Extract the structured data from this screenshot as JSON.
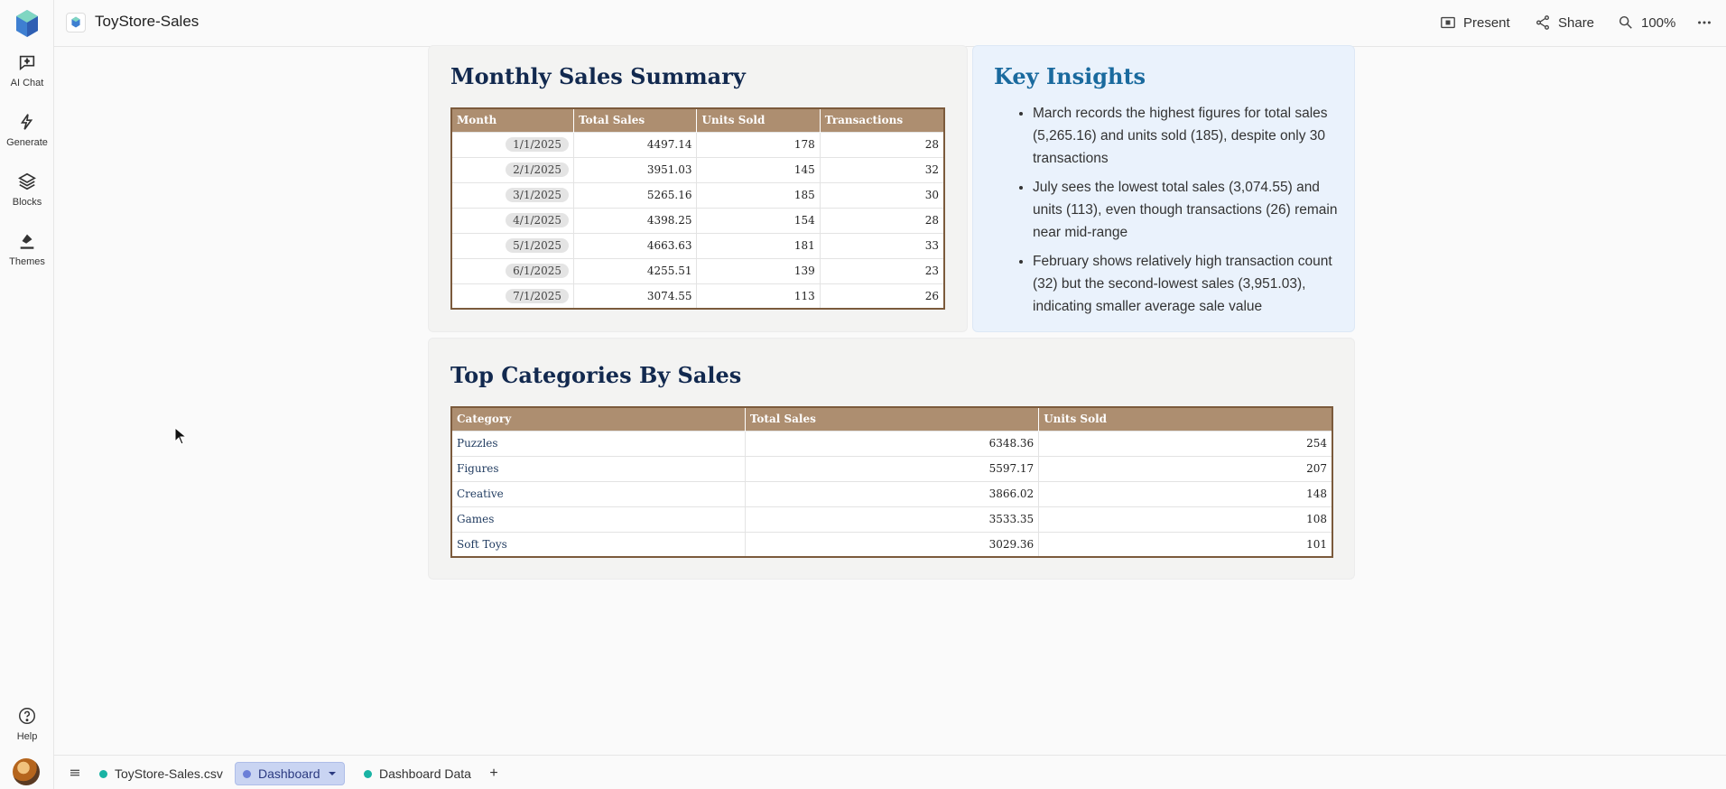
{
  "rail": {
    "items": [
      {
        "label": "AI Chat",
        "icon": "chat-icon"
      },
      {
        "label": "Generate",
        "icon": "sparkle-icon"
      },
      {
        "label": "Blocks",
        "icon": "layers-icon"
      },
      {
        "label": "Themes",
        "icon": "paint-icon"
      }
    ],
    "help_label": "Help"
  },
  "topbar": {
    "title": "ToyStore-Sales",
    "present_label": "Present",
    "share_label": "Share",
    "zoom_label": "100%"
  },
  "monthly": {
    "title": "Monthly Sales Summary",
    "headers": [
      "Month",
      "Total Sales",
      "Units Sold",
      "Transactions"
    ],
    "rows": [
      [
        "1/1/2025",
        "4497.14",
        "178",
        "28"
      ],
      [
        "2/1/2025",
        "3951.03",
        "145",
        "32"
      ],
      [
        "3/1/2025",
        "5265.16",
        "185",
        "30"
      ],
      [
        "4/1/2025",
        "4398.25",
        "154",
        "28"
      ],
      [
        "5/1/2025",
        "4663.63",
        "181",
        "33"
      ],
      [
        "6/1/2025",
        "4255.51",
        "139",
        "23"
      ],
      [
        "7/1/2025",
        "3074.55",
        "113",
        "26"
      ]
    ]
  },
  "insights": {
    "title": "Key Insights",
    "items": [
      "March records the highest figures for total sales (5,265.16) and units sold (185), despite only 30 transactions",
      "July sees the lowest total sales (3,074.55) and units (113), even though transactions (26) remain near mid-range",
      "February shows relatively high transaction count (32) but the second-lowest sales (3,951.03), indicating smaller average sale value"
    ]
  },
  "categories": {
    "title": "Top Categories By Sales",
    "headers": [
      "Category",
      "Total Sales",
      "Units Sold"
    ],
    "rows": [
      [
        "Puzzles",
        "6348.36",
        "254"
      ],
      [
        "Figures",
        "5597.17",
        "207"
      ],
      [
        "Creative",
        "3866.02",
        "148"
      ],
      [
        "Games",
        "3533.35",
        "108"
      ],
      [
        "Soft Toys",
        "3029.36",
        "101"
      ]
    ]
  },
  "bottom_tabs": {
    "tabs": [
      "ToyStore-Sales.csv",
      "Dashboard",
      "Dashboard Data"
    ],
    "active": "Dashboard",
    "add_label": "+"
  },
  "colors": {
    "title_navy": "#12294f",
    "insights_blue": "#1a6a9e",
    "table_header": "#ad8e70",
    "table_border": "#7b5a3c",
    "active_tab": "#c9d4f2"
  }
}
